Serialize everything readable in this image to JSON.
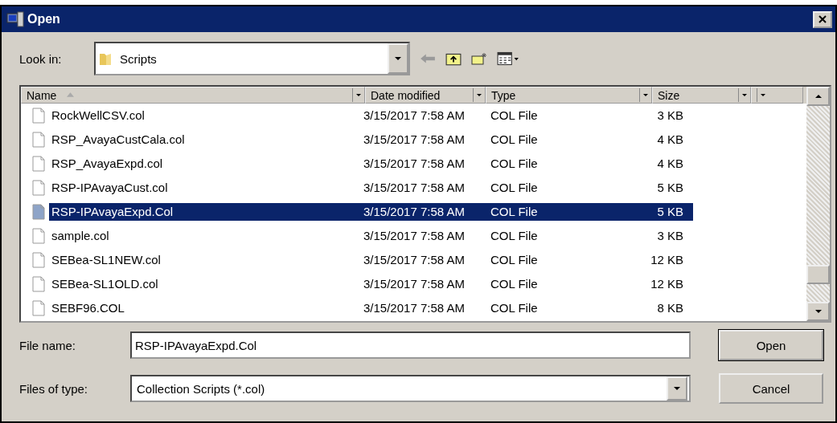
{
  "window": {
    "title": "Open"
  },
  "look_in": {
    "label": "Look in:",
    "value": "Scripts"
  },
  "columns": [
    {
      "label": "Name",
      "sorted": true
    },
    {
      "label": "Date modified",
      "sorted": false
    },
    {
      "label": "Type",
      "sorted": false
    },
    {
      "label": "Size",
      "sorted": false
    }
  ],
  "rows": [
    {
      "name": "RockWellCSV.col",
      "date": "3/15/2017 7:58 AM",
      "type": "COL File",
      "size": "3 KB",
      "selected": false
    },
    {
      "name": "RSP_AvayaCustCala.col",
      "date": "3/15/2017 7:58 AM",
      "type": "COL File",
      "size": "4 KB",
      "selected": false
    },
    {
      "name": "RSP_AvayaExpd.col",
      "date": "3/15/2017 7:58 AM",
      "type": "COL File",
      "size": "4 KB",
      "selected": false
    },
    {
      "name": "RSP-IPAvayaCust.col",
      "date": "3/15/2017 7:58 AM",
      "type": "COL File",
      "size": "5 KB",
      "selected": false
    },
    {
      "name": "RSP-IPAvayaExpd.Col",
      "date": "3/15/2017 7:58 AM",
      "type": "COL File",
      "size": "5 KB",
      "selected": true
    },
    {
      "name": "sample.col",
      "date": "3/15/2017 7:58 AM",
      "type": "COL File",
      "size": "3 KB",
      "selected": false
    },
    {
      "name": "SEBea-SL1NEW.col",
      "date": "3/15/2017 7:58 AM",
      "type": "COL File",
      "size": "12 KB",
      "selected": false
    },
    {
      "name": "SEBea-SL1OLD.col",
      "date": "3/15/2017 7:58 AM",
      "type": "COL File",
      "size": "12 KB",
      "selected": false
    },
    {
      "name": "SEBF96.COL",
      "date": "3/15/2017 7:58 AM",
      "type": "COL File",
      "size": "8 KB",
      "selected": false
    }
  ],
  "file_name": {
    "label": "File name:",
    "value": "RSP-IPAvayaExpd.Col"
  },
  "file_type": {
    "label": "Files of type:",
    "value": "Collection Scripts (*.col)"
  },
  "buttons": [
    "Open",
    "Cancel"
  ]
}
